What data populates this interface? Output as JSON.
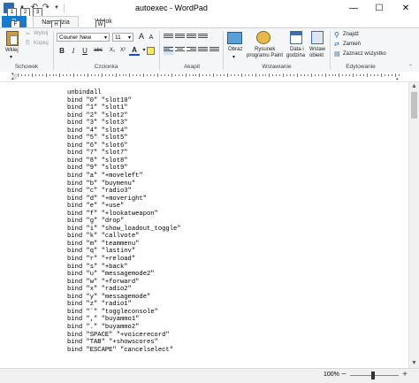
{
  "window": {
    "title": "autoexec - WordPad",
    "minimize_glyph": "—",
    "maximize_glyph": "☐",
    "close_glyph": "✕"
  },
  "qat_keytips": [
    "1",
    "2",
    "3"
  ],
  "tabs": {
    "file": "P",
    "file_keytip": "F",
    "home": "Narzędzia główne",
    "home_keytip": "H",
    "view": "Widok",
    "view_keytip": "W"
  },
  "clipboard": {
    "group": "Schowek",
    "paste": "Wklej",
    "cut": "Wytnij",
    "copy": "Kopiuj"
  },
  "font": {
    "group": "Czcionka",
    "family": "Courier New",
    "size": "11",
    "bold": "B",
    "italic": "I",
    "underline": "U",
    "strike": "abc",
    "subscript": "X₂",
    "superscript": "X²",
    "grow": "A",
    "shrink": "A",
    "color_letter": "A"
  },
  "paragraph": {
    "group": "Akapit"
  },
  "insert": {
    "group": "Wstawianie",
    "picture": "Obraz",
    "paint_line1": "Rysunek",
    "paint_line2": "programu Paint",
    "datetime_line1": "Data i",
    "datetime_line2": "godzina",
    "object_line1": "Wstaw",
    "object_line2": "obiekt"
  },
  "editing": {
    "group": "Edytowanie",
    "find": "Znajdź",
    "replace": "Zamień",
    "select_all": "Zaznacz wszystko"
  },
  "document": {
    "lines": [
      "unbindall",
      "bind \"0\" \"slot10\"",
      "bind \"1\" \"slot1\"",
      "bind \"2\" \"slot2\"",
      "bind \"3\" \"slot3\"",
      "bind \"4\" \"slot4\"",
      "bind \"5\" \"slot5\"",
      "bind \"6\" \"slot6\"",
      "bind \"7\" \"slot7\"",
      "bind \"8\" \"slot8\"",
      "bind \"9\" \"slot9\"",
      "bind \"a\" \"+moveleft\"",
      "bind \"b\" \"buymenu\"",
      "bind \"c\" \"radio3\"",
      "bind \"d\" \"+moveright\"",
      "bind \"e\" \"+use\"",
      "bind \"f\" \"+lookatweapon\"",
      "bind \"g\" \"drop\"",
      "bind \"i\" \"show_loadout_toggle\"",
      "bind \"k\" \"callvote\"",
      "bind \"m\" \"teammenu\"",
      "bind \"q\" \"lastinv\"",
      "bind \"r\" \"+reload\"",
      "bind \"s\" \"+back\"",
      "bind \"u\" \"messagemode2\"",
      "bind \"w\" \"+forward\"",
      "bind \"x\" \"radio2\"",
      "bind \"y\" \"messagemode\"",
      "bind \"z\" \"radio1\"",
      "bind \"`\" \"toggleconsole\"",
      "bind \",\" \"buyammo1\"",
      "bind \".\" \"buyammo2\"",
      "bind \"SPACE\" \"+voicerecord\"",
      "bind \"TAB\" \"+showscores\"",
      "bind \"ESCAPE\" \"cancelselect\""
    ]
  },
  "status": {
    "zoom": "100%",
    "zoom_out": "−",
    "zoom_in": "+"
  }
}
